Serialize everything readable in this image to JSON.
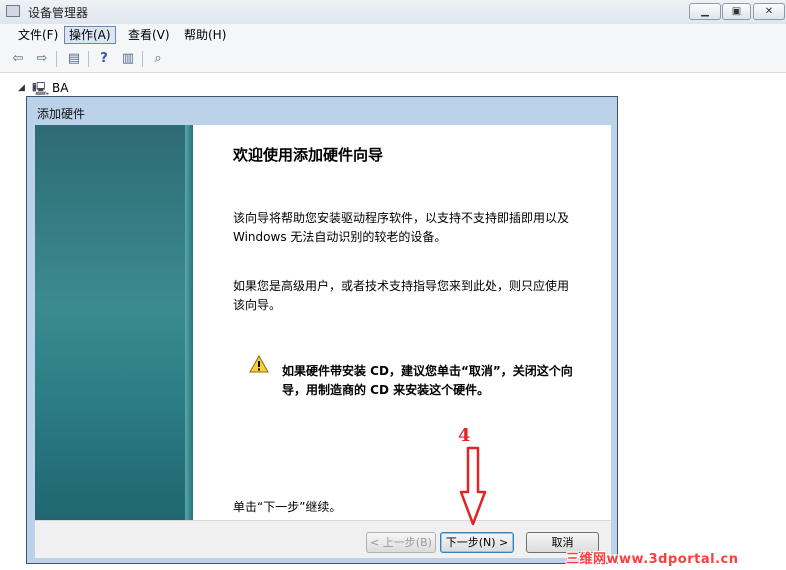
{
  "window": {
    "title": "设备管理器"
  },
  "menu": {
    "items": [
      "文件(F)",
      "操作(A)",
      "查看(V)",
      "帮助(H)"
    ],
    "active_index": 1
  },
  "toolbar": {
    "icons": [
      "back-arrow-icon",
      "forward-arrow-icon",
      "properties-icon",
      "help-icon",
      "console-icon",
      "scan-hardware-icon"
    ]
  },
  "tree": {
    "root_label": "BA"
  },
  "dialog": {
    "title": "添加硬件",
    "heading": "欢迎使用添加硬件向导",
    "para1_line1": "该向导将帮助您安装驱动程序软件，以支持不支持即插即用以及",
    "para1_line2": "Windows 无法自动识别的较老的设备。",
    "para2_line1": "如果您是高级用户，或者技术支持指导您来到此处，则只应使用",
    "para2_line2": "该向导。",
    "warning_line1": "如果硬件带安装 CD，建议您单击“取消”，关闭这个向",
    "warning_line2": "导，用制造商的 CD 来安装这个硬件。",
    "continue_text": "单击“下一步”继续。",
    "buttons": {
      "back": "< 上一步(B)",
      "next": "下一步(N) >",
      "cancel": "取消"
    }
  },
  "annotation": {
    "number": "4",
    "arrow_color": "#e32424"
  },
  "watermark": {
    "text": "三维网www.3dportal.cn"
  }
}
